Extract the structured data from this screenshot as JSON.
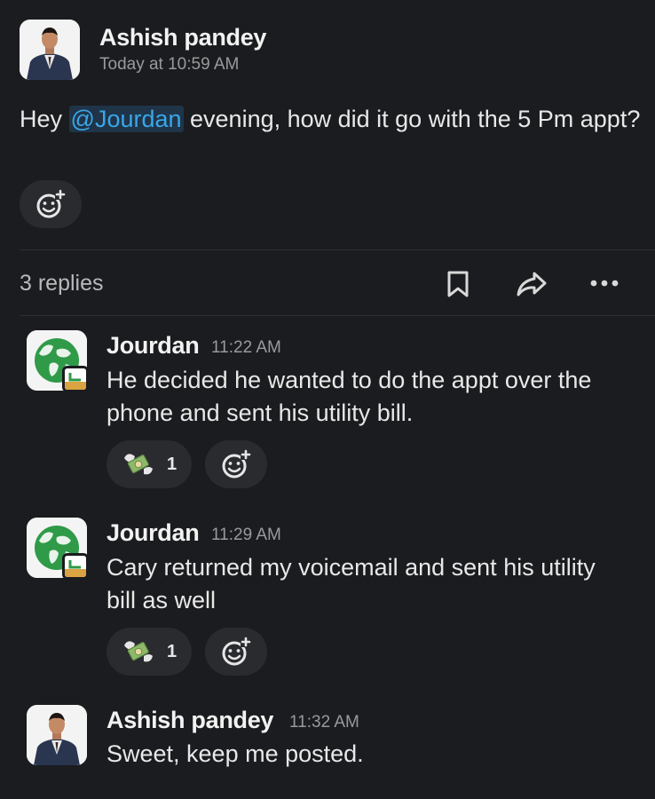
{
  "parent": {
    "author": "Ashish pandey",
    "timestamp": "Today at 10:59 AM",
    "message_before": "Hey ",
    "mention": "@Jourdan",
    "message_after": " evening, how did it go with the 5 Pm appt?"
  },
  "thread": {
    "replies_label": "3 replies"
  },
  "replies": [
    {
      "author": "Jourdan",
      "timestamp": "11:22 AM",
      "text": "He decided he wanted to do the appt over the phone and sent his utility bill.",
      "reaction_emoji": "money-with-wings",
      "reaction_count": "1"
    },
    {
      "author": "Jourdan",
      "timestamp": "11:29 AM",
      "text": "Cary returned my voicemail and sent his utility bill as well",
      "reaction_emoji": "money-with-wings",
      "reaction_count": "1"
    },
    {
      "author": "Ashish pandey",
      "timestamp": "11:32 AM",
      "text": "Sweet, keep me posted."
    }
  ],
  "colors": {
    "background": "#1b1c1f",
    "mention": "#3aa6e8",
    "pill": "#2a2b2f"
  }
}
